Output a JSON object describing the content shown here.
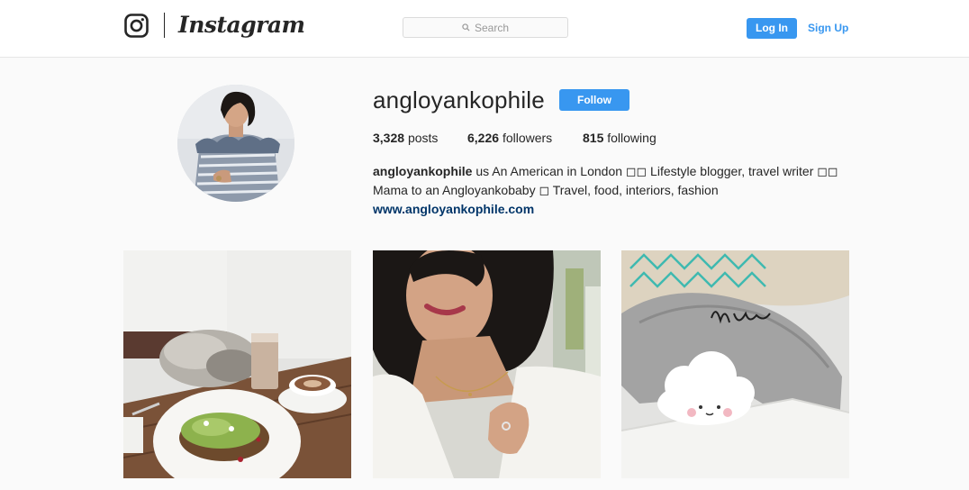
{
  "header": {
    "logo_icon": "instagram-camera-icon",
    "wordmark": "Instagram",
    "search_placeholder": "Search",
    "login_label": "Log In",
    "signup_label": "Sign Up"
  },
  "profile": {
    "username": "angloyankophile",
    "follow_label": "Follow",
    "stats": [
      {
        "value": "3,328",
        "label": "posts"
      },
      {
        "value": "6,226",
        "label": "followers"
      },
      {
        "value": "815",
        "label": "following"
      }
    ],
    "bio": {
      "name": "angloyankophile",
      "line1_text": "us An American in London ◻◻ Lifestyle blogger, travel writer ◻◻",
      "line2_text": "Mama to an Angloyankobaby ◻ Travel, food, interiors, fashion",
      "website": "www.angloyankophile.com"
    }
  },
  "posts": [
    {
      "subject": "avocado toast and coffee on a wooden table"
    },
    {
      "subject": "woman smiling in white blouse"
    },
    {
      "subject": "cloud night light and grey sweater"
    }
  ],
  "colors": {
    "accent": "#3897f0",
    "link": "#003569",
    "background": "#fafafa",
    "text": "#262626"
  }
}
